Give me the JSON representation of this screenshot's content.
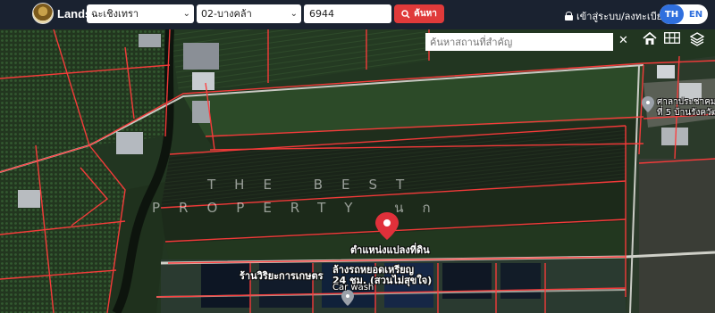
{
  "header": {
    "brand": "LandsMaps",
    "district": "ฉะเชิงเทรา",
    "subdistrict": "02-บางคล้า",
    "parcel_number": "6944",
    "search_label": "ค้นหา",
    "login_label": "เข้าสู่ระบบ/ลงทะเบียน",
    "lang_th": "TH",
    "lang_en": "EN"
  },
  "map": {
    "place_search_placeholder": "ค้นหาสถานที่สำคัญ",
    "close_symbol": "✕",
    "watermark_line1": "THE BEST",
    "watermark_line2": "PROPERTY นก",
    "parcel_marker_label": "ตำแหน่งแปลงที่ดิน",
    "poi_shop": "ร้านวิริยะการเกษตร",
    "poi_carwash_th1": "ล้างรถหยอดเหรียญ",
    "poi_carwash_th2": "24 ชม. (สวนไม่สุขใจ)",
    "poi_carwash_en": "Car wash",
    "poi_hall1": "ศาลาประชาคม",
    "poi_hall2": "ที่ 5 บ้านรังควัฒ",
    "colors": {
      "parcel_line": "#ff3b3b",
      "marker": "#e0303a",
      "navbar": "#1a2230"
    }
  }
}
